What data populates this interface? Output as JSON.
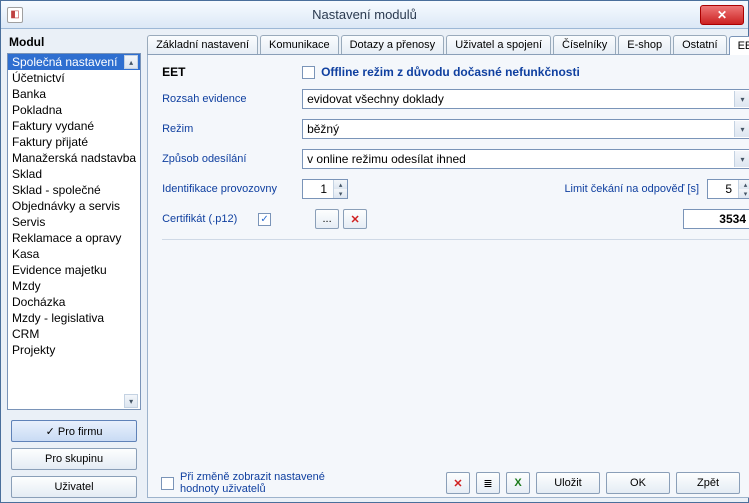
{
  "window": {
    "title": "Nastavení modulů"
  },
  "left": {
    "heading": "Modul",
    "scope": {
      "firm": "✓ Pro firmu",
      "group": "Pro skupinu",
      "user": "Uživatel"
    },
    "items": [
      "Společná nastavení",
      "Účetnictví",
      "Banka",
      "Pokladna",
      "Faktury vydané",
      "Faktury přijaté",
      "Manažerská nadstavba",
      "Sklad",
      "Sklad - společné",
      "Objednávky a servis",
      "Servis",
      "Reklamace a opravy",
      "Kasa",
      "Evidence majetku",
      "Mzdy",
      "Docházka",
      "Mzdy - legislativa",
      "CRM",
      "Projekty"
    ]
  },
  "tabs": {
    "items": [
      "Základní nastavení",
      "Komunikace",
      "Dotazy a přenosy",
      "Uživatel a spojení",
      "Číselníky",
      "E-shop",
      "Ostatní",
      "EET"
    ],
    "active": 7
  },
  "eet": {
    "title": "EET",
    "offline_label": "Offline režim z důvodu dočasné nefunkčnosti",
    "offline_checked": false,
    "rozsah_label": "Rozsah evidence",
    "rozsah_value": "evidovat všechny doklady",
    "rezim_label": "Režim",
    "rezim_value": "běžný",
    "zpusob_label": "Způsob odesílání",
    "zpusob_value": "v online režimu odesílat ihned",
    "provoz_label": "Identifikace provozovny",
    "provoz_value": "1",
    "limit_label": "Limit čekání na odpověď [s]",
    "limit_value": "5",
    "cert_label": "Certifikát (.p12)",
    "cert_checked": true,
    "cert_browse": "...",
    "cert_id": "3534"
  },
  "footer": {
    "hint_checked": false,
    "hint1": "Při změně zobrazit nastavené",
    "hint2": "hodnoty uživatelů",
    "save": "Uložit",
    "ok": "OK",
    "back": "Zpět"
  },
  "icons": {
    "delete_x": "✕",
    "list": "≣",
    "excel": "X",
    "check": "✓",
    "caret": "▾",
    "up": "▴",
    "down": "▾"
  }
}
